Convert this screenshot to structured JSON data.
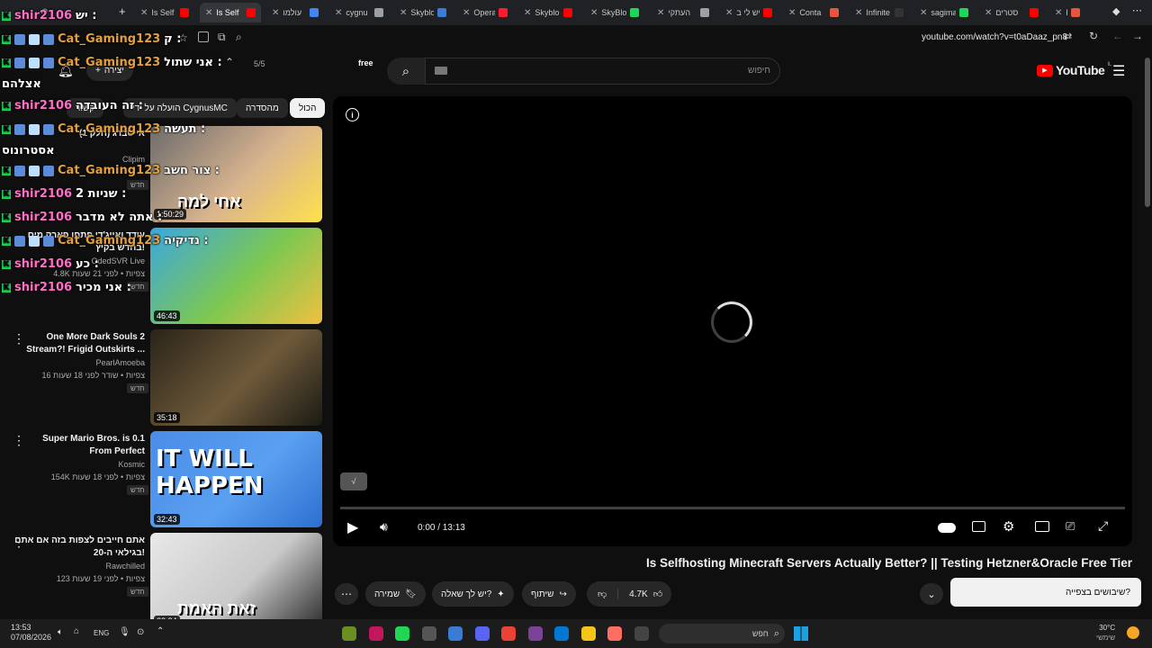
{
  "tabs": [
    {
      "label": "Is Self",
      "active": false,
      "color": "#ff0000"
    },
    {
      "label": "Is Self",
      "active": true,
      "color": "#ff0000"
    },
    {
      "label": "עולמו",
      "active": false,
      "color": "#4285f4"
    },
    {
      "label": "cygnu",
      "active": false,
      "color": "#9aa0a6"
    },
    {
      "label": "Skyblo",
      "active": false,
      "color": "#3a7bd5"
    },
    {
      "label": "Opera",
      "active": false,
      "color": "#ff1b2d"
    },
    {
      "label": "Skyblo",
      "active": false,
      "color": "#ff0000"
    },
    {
      "label": "SkyBlo",
      "active": false,
      "color": "#1fd655"
    },
    {
      "label": "העתקי",
      "active": false,
      "color": "#9aa0a6"
    },
    {
      "label": "יש לי ב",
      "active": false,
      "color": "#ff0000"
    },
    {
      "label": "Conta",
      "active": false,
      "color": "#e8553d"
    },
    {
      "label": "Infinite",
      "active": false,
      "color": "#333333"
    },
    {
      "label": "sagima",
      "active": false,
      "color": "#1fd655"
    },
    {
      "label": "סטרים",
      "active": false,
      "color": "#ff0000"
    },
    {
      "label": "Re",
      "active": false,
      "color": "#e8553d"
    }
  ],
  "address": {
    "url": "youtube.com/watch?v=t0aDaaz_pn8",
    "find_count": "5/5",
    "find_query": "free"
  },
  "youtube": {
    "logo_text": "YouTube",
    "logo_region": "IL",
    "search_placeholder": "חיפוש",
    "create_label": "יצירה"
  },
  "chips": [
    {
      "label": "הכול",
      "selected": true
    },
    {
      "label": "מהסדרה",
      "selected": false
    },
    {
      "label": "הועלה על ידי CygnusMC",
      "selected": false
    },
    {
      "label": "קשור",
      "selected": false
    }
  ],
  "chat": [
    {
      "user": "shir2106",
      "msg": "יש :",
      "color": "#ff6ec7",
      "badges": 0
    },
    {
      "user": "Cat_Gaming123",
      "msg": "ק :",
      "color": "#e2a03f",
      "badges": 3
    },
    {
      "user": "Cat_Gaming123",
      "msg": "אני שתול :",
      "color": "#e2a03f",
      "badges": 3
    },
    {
      "user": "",
      "msg": "אצלהם",
      "color": "#ffffff",
      "badges": 0
    },
    {
      "user": "shir2106",
      "msg": "זה העובדה :",
      "color": "#ff6ec7",
      "badges": 0
    },
    {
      "user": "Cat_Gaming123",
      "msg": "תעשה :",
      "color": "#e2a03f",
      "badges": 3
    },
    {
      "user": "",
      "msg": "אסטרונוס",
      "color": "#ffffff",
      "badges": 0
    },
    {
      "user": "Cat_Gaming123",
      "msg": "צור חשב :",
      "color": "#e2a03f",
      "badges": 3
    },
    {
      "user": "shir2106",
      "msg": "שניות 2 :",
      "color": "#ff6ec7",
      "badges": 0
    },
    {
      "user": "shir2106",
      "msg": "אתה לא מדבר :",
      "color": "#ff6ec7",
      "badges": 0
    },
    {
      "user": "Cat_Gaming123",
      "msg": "נדיקיה :",
      "color": "#e2a03f",
      "badges": 3
    },
    {
      "user": "shir2106",
      "msg": "כע :",
      "color": "#ff6ec7",
      "badges": 0
    },
    {
      "user": "shir2106",
      "msg": "אני מכיר :",
      "color": "#ff6ec7",
      "badges": 0
    }
  ],
  "videos": [
    {
      "title1": "אייסברג (חלק 1)",
      "title2": "",
      "channel": "Clipim",
      "meta": "",
      "duration": "1:50:29",
      "new": "חדש",
      "overlay_text": "אחי למה",
      "thumb_colors": [
        "#6b6b6b",
        "#d9b48f",
        "#ffe14a"
      ]
    },
    {
      "title1": "עודד ואייג'די פתחו פארק מים",
      "title2": "בחדש בקיץ!",
      "channel": "OdedSVR Live",
      "meta": "4.8K צפיות • לפני 21 שעות",
      "duration": "46:43",
      "new": "חדש",
      "overlay_text": "",
      "thumb_colors": [
        "#3ba7e0",
        "#7ec850",
        "#f0c040"
      ]
    },
    {
      "title1": "One More Dark Souls 2",
      "title2": "Stream?! Frigid Outskirts ...",
      "channel": "PearlAmoeba",
      "meta": "16 צפיות • שודר לפני 18 שעות",
      "duration": "35:18",
      "new": "חדש",
      "overlay_text": "",
      "thumb_colors": [
        "#2a2418",
        "#6e5a3a",
        "#1b1a14"
      ]
    },
    {
      "title1": "Super Mario Bros. is 0.1",
      "title2": "From Perfect",
      "channel": "Kosmic",
      "meta": "154K צפיות • לפני 18 שעות",
      "duration": "32:43",
      "new": "חדש",
      "overlay_text": "IT WILL HAPPEN",
      "thumb_colors": [
        "#4a8be8",
        "#5aa0f0",
        "#2c6fd1"
      ]
    },
    {
      "title1": "אתם חייבים לצפות בזה אם אתם",
      "title2": "בגילאי ה-20!",
      "channel": "Rawchilled",
      "meta": "123 צפיות • לפני 19 שעות",
      "duration": "32:34",
      "new": "חדש",
      "overlay_text": "זאת האמת",
      "thumb_colors": [
        "#e8e8e8",
        "#c9c9c9",
        "#2b2b2b"
      ]
    }
  ],
  "player": {
    "time": "0:00 / 13:13",
    "title": "Is Selfhosting Minecraft Servers Actually Better? || Testing Hetzner&Oracle Free Tier"
  },
  "actions": {
    "likes": "4.7K",
    "share": "שיתוף",
    "ask": "יש לך שאלה?",
    "save": "שמירה",
    "toast": "שיבושים בצפייה?"
  },
  "taskbar": {
    "time": "13:53",
    "date": "07/08/2026",
    "lang": "ENG",
    "search": "חפש",
    "weather_temp": "30°C",
    "weather_desc": "שימשי"
  }
}
